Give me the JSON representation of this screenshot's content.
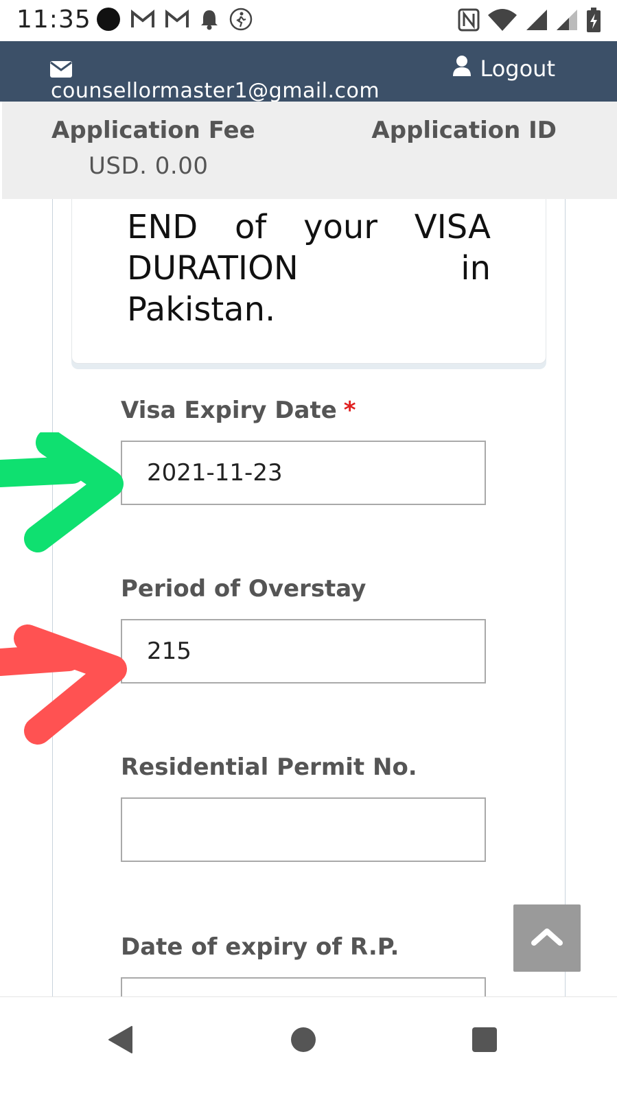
{
  "status_bar": {
    "time": "11:35",
    "left_icons": [
      "record-dot-icon",
      "gmail-icon",
      "gmail-icon",
      "bell-icon",
      "walk-icon"
    ],
    "right_icons": [
      "nfc-icon",
      "wifi-icon",
      "signal-icon",
      "signal-icon",
      "battery-charging-icon"
    ]
  },
  "header": {
    "email": "counsellormaster1@gmail.com",
    "logout_label": "Logout",
    "background": "#3c5068"
  },
  "fee_bar": {
    "fee_label": "Application Fee",
    "fee_value": "USD. 0.00",
    "id_label": "Application ID"
  },
  "note": {
    "text": "END of your VISA DURATION in Pakistan."
  },
  "form": {
    "visa_expiry": {
      "label": "Visa Expiry Date",
      "required_mark": "*",
      "value": "2021-11-23"
    },
    "overstay": {
      "label": "Period of Overstay",
      "value": "215"
    },
    "permit": {
      "label": "Residential Permit No.",
      "value": ""
    },
    "rp_expiry": {
      "label": "Date of expiry of R.P.",
      "value": ""
    }
  },
  "colors": {
    "green_arrow": "#0fe070",
    "red_arrow": "#ff5252",
    "required": "#e02020"
  }
}
